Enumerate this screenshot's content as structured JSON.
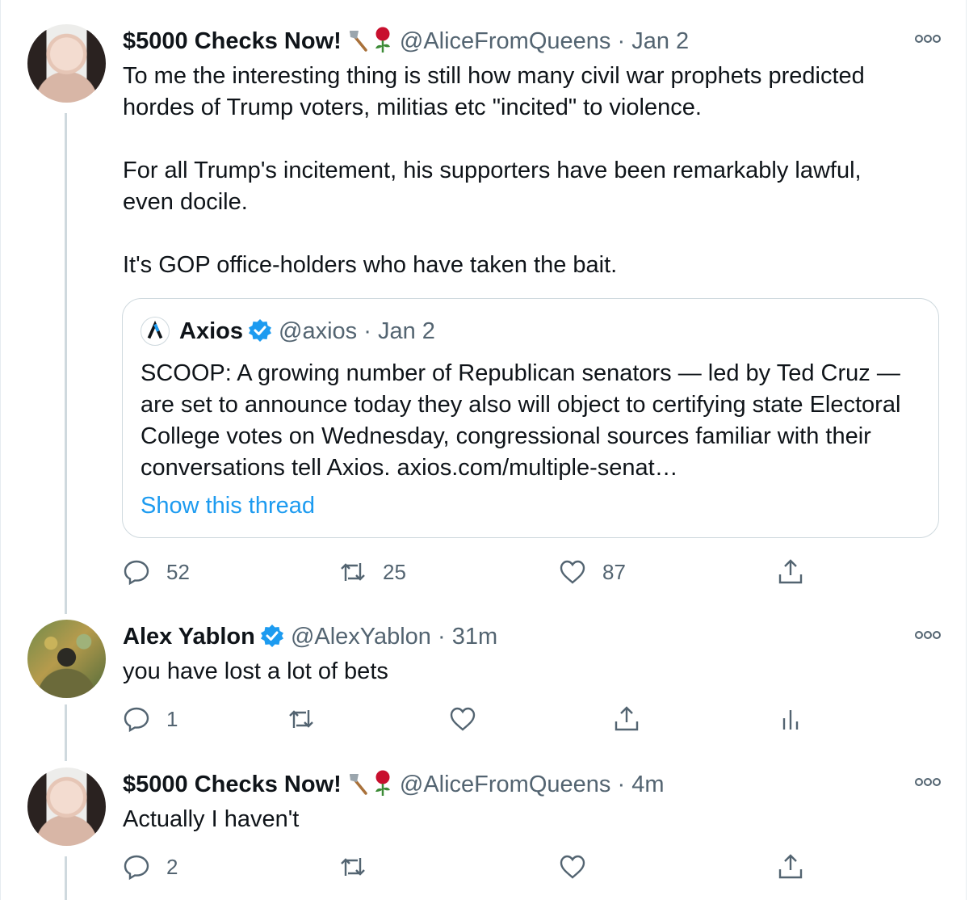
{
  "tweets": [
    {
      "name": "$5000 Checks Now!",
      "handle": "@AliceFromQueens",
      "time": "Jan 2",
      "text": "To me the interesting thing is still how many civil war prophets predicted\nhordes of Trump voters, militias etc \"incited\" to violence.\n\nFor all Trump's incitement, his supporters have been remarkably lawful,\neven docile.\n\nIt's GOP office-holders who have taken the bait.",
      "reply_count": "52",
      "retweet_count": "25",
      "like_count": "87",
      "quote": {
        "name": "Axios",
        "handle": "@axios",
        "time": "Jan 2",
        "text": "SCOOP: A  growing number of Republican senators — led by Ted Cruz — are set to announce today they also will object to certifying state Electoral College votes on Wednesday, congressional sources familiar with their conversations tell Axios. axios.com/multiple-senat…",
        "show_thread": "Show this thread"
      }
    },
    {
      "name": "Alex Yablon",
      "handle": "@AlexYablon",
      "time": "31m",
      "text": "you have lost a lot of bets",
      "reply_count": "1"
    },
    {
      "name": "$5000 Checks Now!",
      "handle": "@AliceFromQueens",
      "time": "4m",
      "text": "Actually I haven't",
      "reply_count": "2"
    }
  ],
  "separator": "·",
  "colors": {
    "link": "#1d9bf0",
    "muted": "#536471",
    "verified": "#1d9bf0",
    "thread_line": "#cfd9de"
  },
  "icons": [
    "more-icon",
    "reply-icon",
    "retweet-icon",
    "like-icon",
    "share-icon",
    "analytics-icon",
    "verified-badge-icon",
    "axe-emoji-icon",
    "rose-emoji-icon",
    "axios-logo-icon"
  ]
}
